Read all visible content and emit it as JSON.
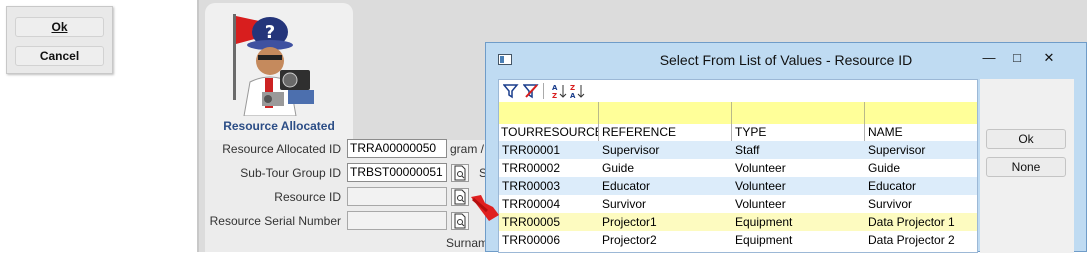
{
  "left_panel": {
    "ok_label": "Ok",
    "cancel_label": "Cancel"
  },
  "form": {
    "caption": "Resource Allocated",
    "fields": [
      {
        "label": "Resource Allocated ID",
        "value": "TRRA00000050"
      },
      {
        "label": "Sub-Tour Group ID",
        "value": "TRBST00000051"
      },
      {
        "label": "Resource ID",
        "value": ""
      },
      {
        "label": "Resource Serial Number",
        "value": ""
      }
    ],
    "clipped_texts": [
      "gram / T",
      "S",
      "Surname"
    ]
  },
  "dialog": {
    "title": "Select From List of Values - Resource ID",
    "ok_label": "Ok",
    "none_label": "None",
    "columns": [
      "TOURRESOURCEID",
      "REFERENCE",
      "TYPE",
      "NAME"
    ],
    "rows": [
      {
        "id": "TRR00001",
        "reference": "Supervisor",
        "type": "Staff",
        "name": "Supervisor"
      },
      {
        "id": "TRR00002",
        "reference": "Guide",
        "type": "Volunteer",
        "name": "Guide"
      },
      {
        "id": "TRR00003",
        "reference": "Educator",
        "type": "Volunteer",
        "name": "Educator"
      },
      {
        "id": "TRR00004",
        "reference": "Survivor",
        "type": "Volunteer",
        "name": "Survivor"
      },
      {
        "id": "TRR00005",
        "reference": "Projector1",
        "type": "Equipment",
        "name": "Data Projector 1"
      },
      {
        "id": "TRR00006",
        "reference": "Projector2",
        "type": "Equipment",
        "name": "Data Projector 2"
      }
    ],
    "selected_row": 4,
    "toolbar_icons": [
      "filter-icon",
      "clear-filter-icon",
      "sort-ascending-icon",
      "sort-descending-icon"
    ]
  },
  "colors": {
    "dialog_bg": "#bfdbf2",
    "filter_row": "#ffff99",
    "row_alt": "#dcecfa",
    "row_selected": "#fdfbc0",
    "accent_caption": "#2b4d86",
    "arrow": "#e02020"
  }
}
